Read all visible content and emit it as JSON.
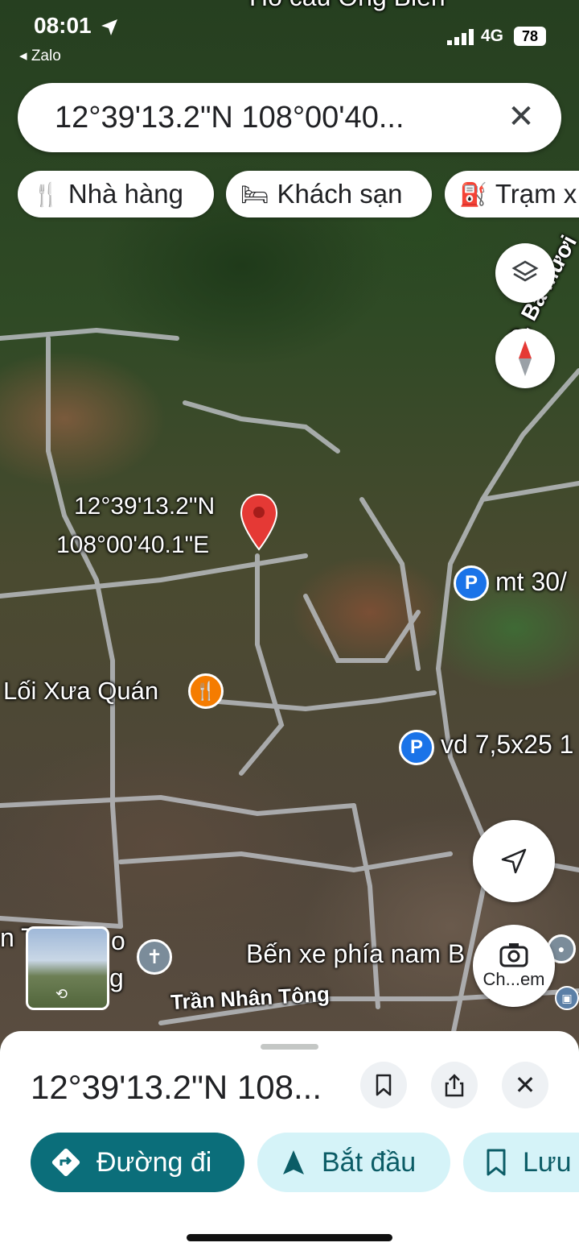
{
  "status_bar": {
    "time": "08:01",
    "back_app": "◂ Zalo",
    "network": "4G",
    "battery": "78"
  },
  "top_partial_label": "Hồ cầu Ông Biên",
  "search": {
    "query": "12°39'13.2\"N 108°00'40..."
  },
  "chips": [
    {
      "label": "Nhà hàng",
      "icon": "restaurant-icon"
    },
    {
      "label": "Khách sạn",
      "icon": "hotel-icon"
    },
    {
      "label": "Trạm x",
      "icon": "gas-station-icon"
    }
  ],
  "map": {
    "pin_label_line1": "12°39'13.2\"N",
    "pin_label_line2": "108°00'40.1\"E",
    "road_label": "Đ. Ba Mươi",
    "road_label_bottom": "Trần Nhân Tông",
    "poi_restaurant": "Lối Xưa Quán",
    "poi_parking_1": "mt 30/",
    "poi_parking_2": "vd 7,5x25 1",
    "poi_bus": "Bến xe phía nam B",
    "poi_church_partial_1": "n T",
    "poi_church_partial_2": "o",
    "poi_church_partial_3": "g",
    "camera_label": "Ch...em"
  },
  "sheet": {
    "title": "12°39'13.2\"N 108...",
    "actions": [
      {
        "label": "Đường đi",
        "style": "primary"
      },
      {
        "label": "Bắt đầu",
        "style": "secondary"
      },
      {
        "label": "Lưu",
        "style": "secondary"
      }
    ]
  },
  "colors": {
    "primary": "#0b6e7a",
    "secondary_bg": "#d5f3f8",
    "secondary_fg": "#0b5c66",
    "pin": "#e53935",
    "parking": "#1a73e8",
    "restaurant": "#f57c00"
  }
}
